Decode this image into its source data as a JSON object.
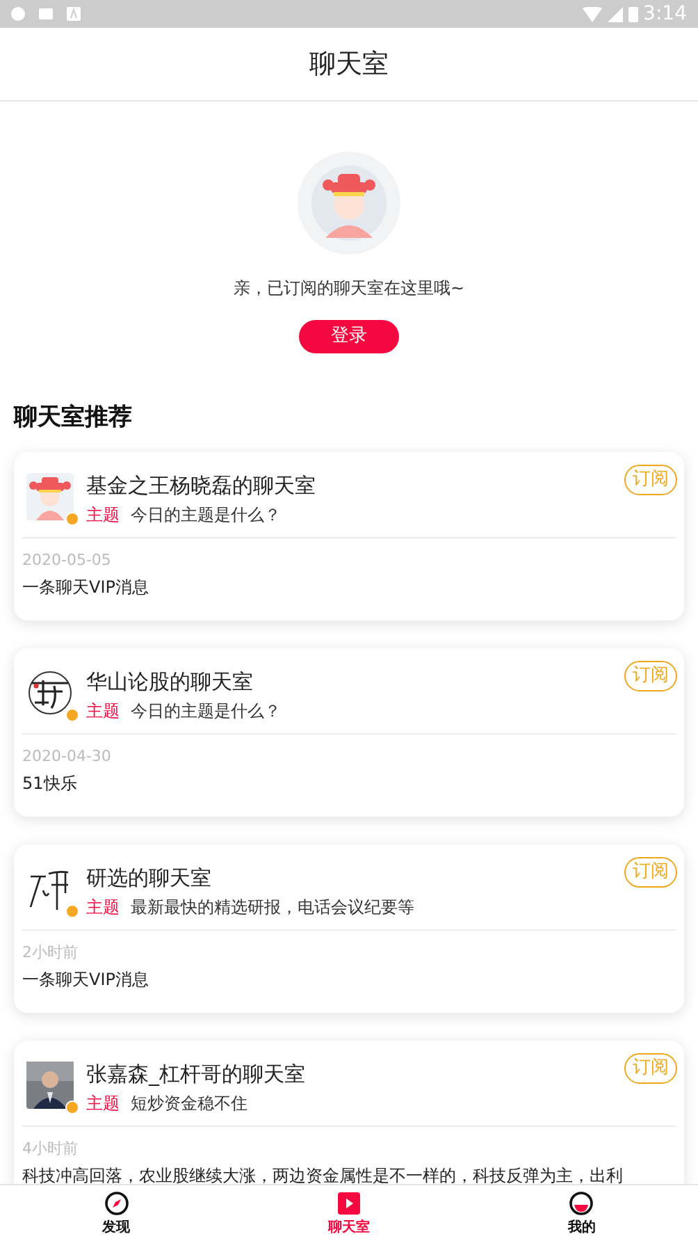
{
  "status_bar": {
    "time": "3:14"
  },
  "header": {
    "title": "聊天室"
  },
  "empty_state": {
    "message": "亲，已订阅的聊天室在这里哦~",
    "login_button": "登录"
  },
  "section": {
    "title": "聊天室推荐"
  },
  "rooms": [
    {
      "avatar": {
        "kind": "cartoon"
      },
      "verified": true,
      "name": "基金之王杨晓磊的聊天室",
      "topic_label": "主题",
      "topic": "今日的主题是什么？",
      "subscribe": "订阅",
      "time": "2020-05-05",
      "message": "一条聊天VIP消息"
    },
    {
      "avatar": {
        "kind": "calligraphy"
      },
      "verified": true,
      "name": "华山论股的聊天室",
      "topic_label": "主题",
      "topic": "今日的主题是什么？",
      "subscribe": "订阅",
      "time": "2020-04-30",
      "message": "51快乐"
    },
    {
      "avatar": {
        "kind": "signature"
      },
      "verified": true,
      "name": "研选的聊天室",
      "topic_label": "主题",
      "topic": "最新最快的精选研报，电话会议纪要等",
      "subscribe": "订阅",
      "time": "2小时前",
      "message": "一条聊天VIP消息"
    },
    {
      "verified": true,
      "name": "张嘉森_杠杆哥的聊天室",
      "topic_label": "主题",
      "topic": "短炒资金稳不住",
      "subscribe": "订阅",
      "time": "4小时前",
      "message": "科技冲高回落，农业股继续大涨，两边资金属性是不一样的，科技反弹为主，出利"
    }
  ],
  "tab_bar": [
    {
      "kind": "compass",
      "label": "发现",
      "selected": false
    },
    {
      "kind": "play",
      "label": "聊天室",
      "selected": true
    },
    {
      "kind": "face",
      "label": "我的",
      "selected": false
    }
  ]
}
